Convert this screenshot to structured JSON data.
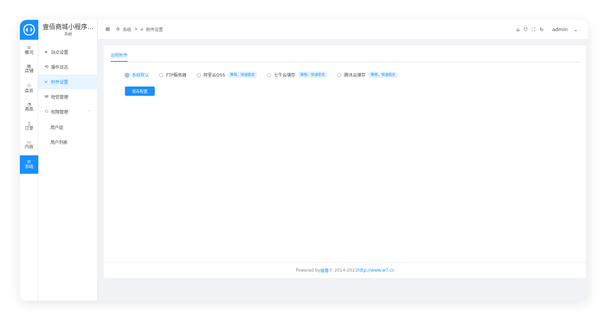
{
  "app": {
    "title": "壹佰商城小程序...",
    "subtitle": "系统"
  },
  "rail": [
    {
      "label": "概况",
      "icon": "⊙"
    },
    {
      "label": "店铺",
      "icon": "▤"
    },
    {
      "label": "会员",
      "icon": "⚇"
    },
    {
      "label": "商品",
      "icon": "◔"
    },
    {
      "label": "订单",
      "icon": "▯"
    },
    {
      "label": "内容",
      "icon": "▭"
    },
    {
      "label": "系统",
      "icon": "⚙"
    }
  ],
  "sidebar": [
    {
      "label": "站点设置",
      "icon": "⚹"
    },
    {
      "label": "操作日志",
      "icon": "⟲"
    },
    {
      "label": "附件设置",
      "icon": "⌀"
    },
    {
      "label": "短信管理",
      "icon": "✉"
    },
    {
      "label": "权限管理",
      "icon": "⚇"
    },
    {
      "label": "用户组"
    },
    {
      "label": "用户列表"
    }
  ],
  "header": {
    "breadcrumb": [
      "系统",
      ">",
      "附件设置"
    ],
    "user": "admin"
  },
  "tab": "远程附件",
  "storage": {
    "options": [
      {
        "label": "系统默认",
        "tag": ""
      },
      {
        "label": "FTP服务器",
        "tag": ""
      },
      {
        "label": "阿里云OSS",
        "tag": "推荐，快速稳定"
      },
      {
        "label": "七牛云储存",
        "tag": "推荐，快速稳定"
      },
      {
        "label": "腾讯云储存",
        "tag": "推荐，快速稳定"
      }
    ],
    "selected": "系统默认"
  },
  "save_label": "保存配置",
  "footer": {
    "prefix": "Powered by ",
    "brand": "微擎",
    "mid": " © 2014-2021 ",
    "link": "http://www.w7.cc"
  }
}
